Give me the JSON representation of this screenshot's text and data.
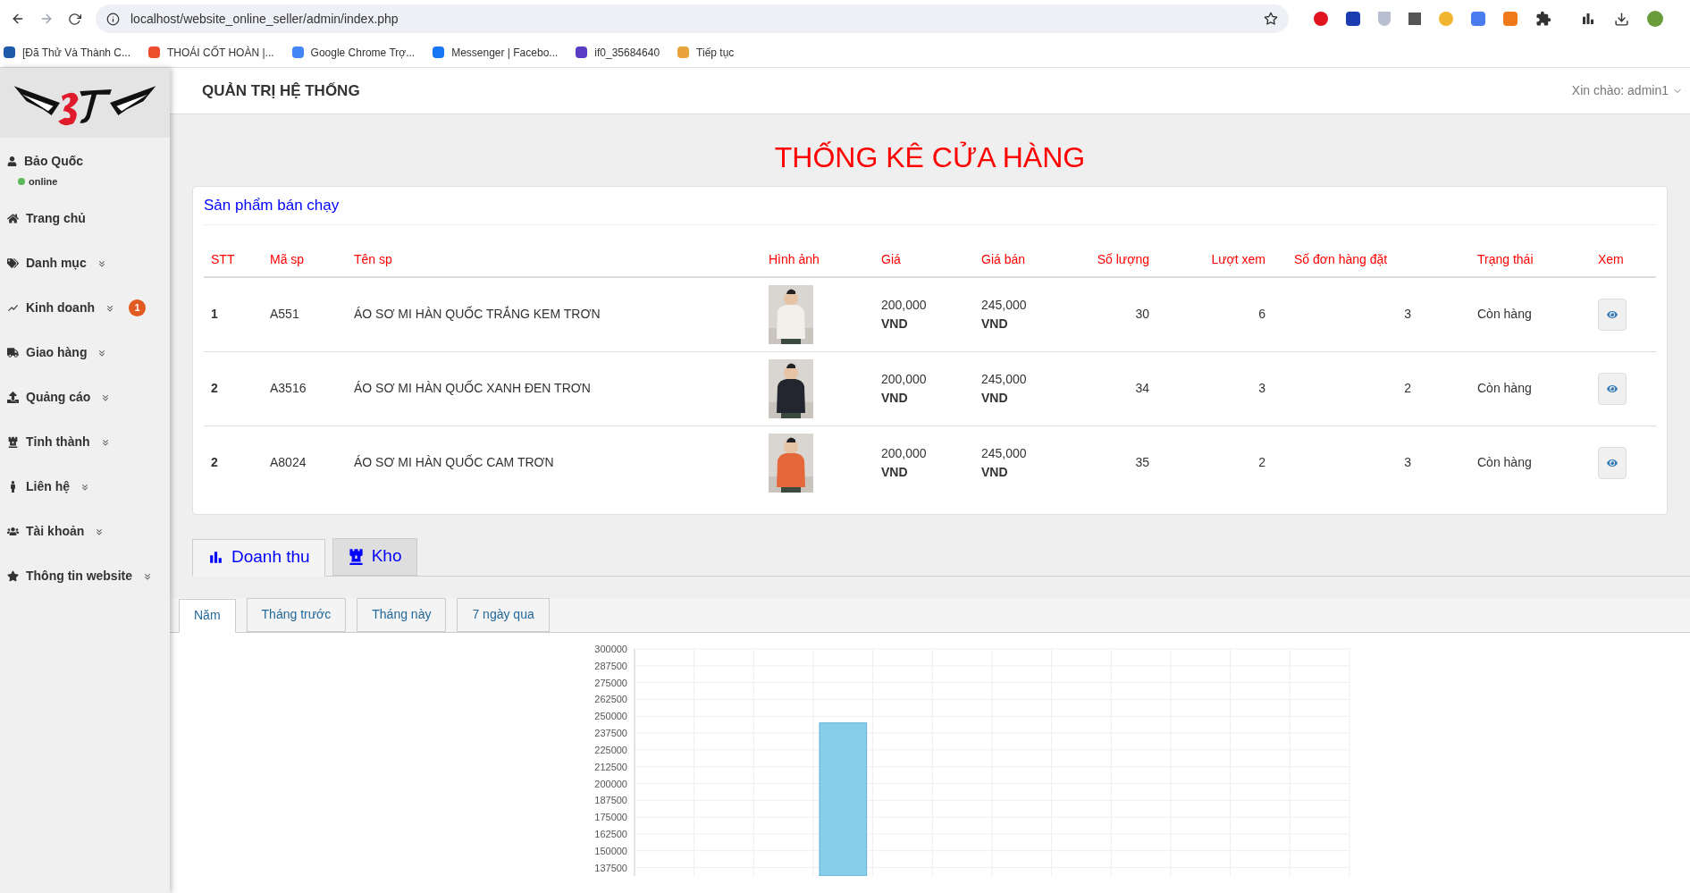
{
  "browser": {
    "url": "localhost/website_online_seller/admin/index.php",
    "bookmarks": [
      {
        "label": "[Đã Thử Và Thành C...",
        "color": "#1e5aa8"
      },
      {
        "label": "THOÁI CỐT HOÀN |...",
        "color": "#ee4d2d"
      },
      {
        "label": "Google Chrome Trợ...",
        "color": "#4285f4"
      },
      {
        "label": "Messenger | Facebo...",
        "color": "#1877f2"
      },
      {
        "label": "if0_35684640",
        "color": "#5b3cc4"
      },
      {
        "label": "Tiếp tục",
        "color": "#e8a33d"
      }
    ]
  },
  "sidebar": {
    "user": {
      "name": "Bảo Quốc",
      "status": "online"
    },
    "items": [
      {
        "label": "Trang chủ",
        "expandable": false
      },
      {
        "label": "Danh mục",
        "expandable": true
      },
      {
        "label": "Kinh doanh",
        "expandable": true,
        "badge": "1"
      },
      {
        "label": "Giao hàng",
        "expandable": true
      },
      {
        "label": "Quảng cáo",
        "expandable": true
      },
      {
        "label": "Tỉnh thành",
        "expandable": true
      },
      {
        "label": "Liên hệ",
        "expandable": true
      },
      {
        "label": "Tài khoản",
        "expandable": true
      },
      {
        "label": "Thông tin website",
        "expandable": true
      }
    ]
  },
  "header": {
    "title": "QUẢN TRỊ HỆ THỐNG",
    "greeting": "Xin chào: admin1"
  },
  "page_title": "THỐNG KÊ CỬA HÀNG",
  "best_sellers": {
    "title": "Sản phẩm bán chạy",
    "columns": [
      "STT",
      "Mã sp",
      "Tên sp",
      "Hình ảnh",
      "Giá",
      "Giá bán",
      "Số lượng",
      "Lượt xem",
      "Số đơn hàng đặt",
      "Trạng thái",
      "Xem"
    ],
    "rows": [
      {
        "stt": "1",
        "code": "A551",
        "name": "ÁO SƠ MI HÀN QUỐC TRẮNG KEM TRƠN",
        "price": "200,000",
        "price_unit": "VND",
        "sale_price": "245,000",
        "sale_unit": "VND",
        "quantity": "30",
        "views": "6",
        "orders": "3",
        "status": "Còn hàng"
      },
      {
        "stt": "2",
        "code": "A3516",
        "name": "ÁO SƠ MI HÀN QUỐC XANH ĐEN TRƠN",
        "price": "200,000",
        "price_unit": "VND",
        "sale_price": "245,000",
        "sale_unit": "VND",
        "quantity": "34",
        "views": "3",
        "orders": "2",
        "status": "Còn hàng"
      },
      {
        "stt": "2",
        "code": "A8024",
        "name": "ÁO SƠ MI HÀN QUỐC CAM TRƠN",
        "price": "200,000",
        "price_unit": "VND",
        "sale_price": "245,000",
        "sale_unit": "VND",
        "quantity": "35",
        "views": "2",
        "orders": "3",
        "status": "Còn hàng"
      }
    ]
  },
  "tabs": [
    {
      "label": "Doanh thu",
      "selected": true
    },
    {
      "label": "Kho",
      "selected": false
    }
  ],
  "periods": [
    {
      "label": "Năm",
      "selected": true
    },
    {
      "label": "Tháng trước",
      "selected": false
    },
    {
      "label": "Tháng này",
      "selected": false
    },
    {
      "label": "7 ngày qua",
      "selected": false
    }
  ],
  "chart_data": {
    "type": "bar",
    "grid": true,
    "values": [
      null,
      null,
      null,
      245000,
      null,
      null,
      null,
      null,
      null,
      null,
      null,
      null
    ],
    "ylim": [
      131250,
      300000
    ],
    "yticks": [
      137500,
      150000,
      162500,
      175000,
      187500,
      200000,
      212500,
      225000,
      237500,
      250000,
      262500,
      275000,
      287500,
      300000
    ]
  }
}
